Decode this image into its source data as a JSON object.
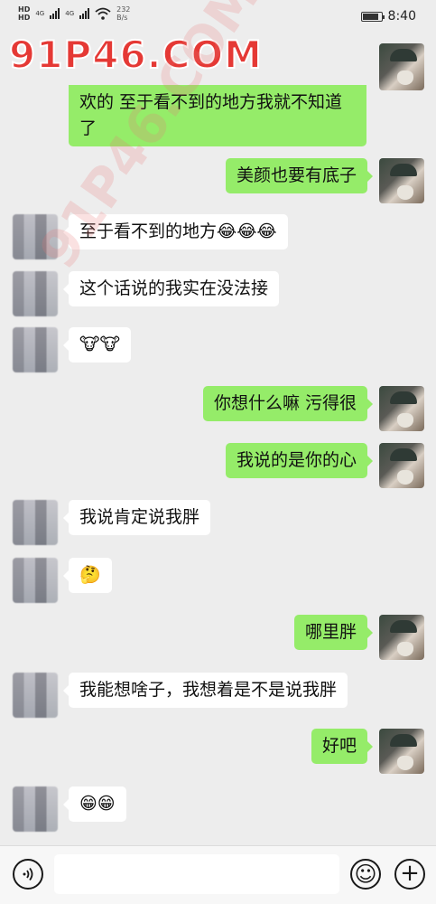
{
  "status_bar": {
    "hd_1": "HD",
    "hd_2": "HD",
    "net_1": "4G",
    "net_2": "4G",
    "speed_value": "232",
    "speed_unit": "B/s",
    "time": "8:40"
  },
  "watermark": {
    "brand": "91P46.COM",
    "diagonal": "91P46.COM"
  },
  "messages": [
    {
      "side": "me",
      "text": "欢的 至于看不到的地方我就不知道了"
    },
    {
      "side": "me",
      "text": "美颜也要有底子"
    },
    {
      "side": "them",
      "text": "至于看不到的地方😂😂😂"
    },
    {
      "side": "them",
      "text": "这个话说的我实在没法接"
    },
    {
      "side": "them",
      "text": "🐮🐮"
    },
    {
      "side": "me",
      "text": "你想什么嘛 污得很"
    },
    {
      "side": "me",
      "text": "我说的是你的心"
    },
    {
      "side": "them",
      "text": "我说肯定说我胖"
    },
    {
      "side": "them",
      "text": "🤔"
    },
    {
      "side": "me",
      "text": "哪里胖"
    },
    {
      "side": "them",
      "text": "我能想啥子，我想着是不是说我胖"
    },
    {
      "side": "me",
      "text": "好吧"
    },
    {
      "side": "them",
      "text": "😁😁"
    }
  ],
  "input_bar": {
    "voice_icon": "voice-icon",
    "emoji_icon": "emoji-icon",
    "plus_icon": "plus-icon",
    "plus_glyph": "+",
    "emoji_glyph": "☺",
    "input_value": ""
  },
  "colors": {
    "background": "#ededed",
    "my_bubble": "#95ec69",
    "their_bubble": "#ffffff",
    "watermark": "#e53935"
  }
}
